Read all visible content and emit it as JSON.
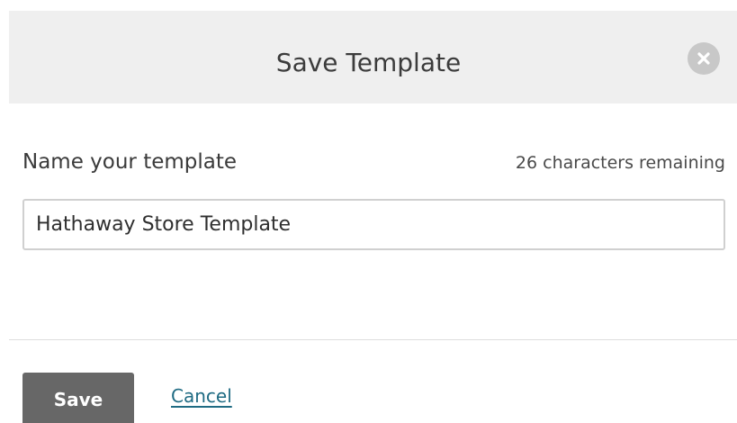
{
  "dialog": {
    "title": "Save Template",
    "close_icon": "close-circle-icon"
  },
  "form": {
    "label": "Name your template",
    "counter": "26 characters remaining",
    "name_value": "Hathaway Store Template"
  },
  "actions": {
    "save_label": "Save",
    "cancel_label": "Cancel"
  },
  "colors": {
    "header_bg": "#efefef",
    "save_bg": "#676767",
    "link": "#1f6b83"
  }
}
